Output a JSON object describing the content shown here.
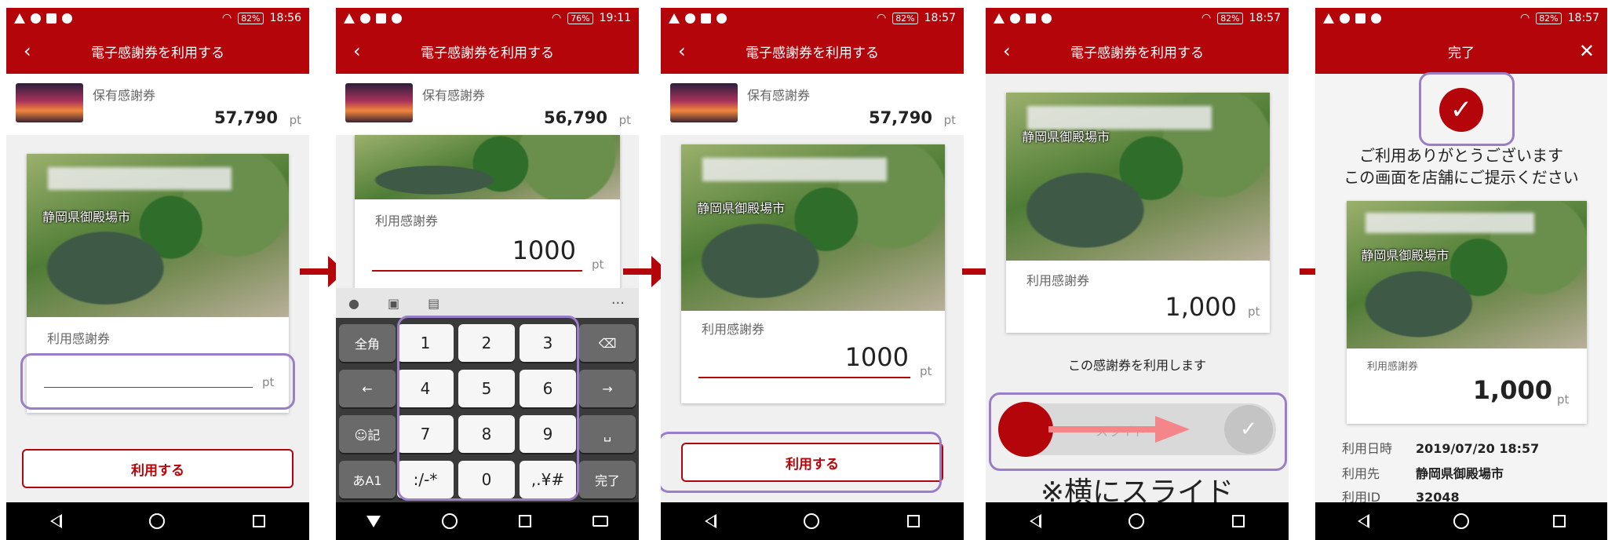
{
  "common": {
    "app_title": "電子感謝券を利用する",
    "balance_label": "保有感謝券",
    "use_label": "利用感謝券",
    "unit": "pt",
    "city": "静岡県御殿場市",
    "use_button": "利用する",
    "back_glyph": "‹"
  },
  "screens": [
    {
      "time": "18:56",
      "battery": "82%",
      "balance": "57,790",
      "amount": ""
    },
    {
      "time": "19:11",
      "battery": "76%",
      "balance": "56,790",
      "amount": "1000"
    },
    {
      "time": "18:57",
      "battery": "82%",
      "balance": "57,790",
      "amount": "1000"
    },
    {
      "time": "18:57",
      "battery": "82%",
      "amount": "1,000",
      "confirm_text": "この感謝券を利用します",
      "slider_text": "スライド",
      "slide_note": "※横にスライド"
    },
    {
      "time": "18:57",
      "battery": "82%",
      "title": "完了",
      "close_glyph": "✕",
      "thanks_line1": "ご利用ありがとうございます",
      "thanks_line2": "この画面を店舗にご提示ください",
      "amount": "1,000",
      "info": [
        {
          "key": "利用日時",
          "value": "2019/07/20 18:57"
        },
        {
          "key": "利用先",
          "value": "静岡県御殿場市"
        },
        {
          "key": "利用ID",
          "value": "32048"
        }
      ]
    }
  ],
  "keyboard": {
    "keys": [
      "1",
      "2",
      "3",
      "4",
      "5",
      "6",
      "7",
      "8",
      "9",
      ":/-*",
      "0",
      ",.¥#"
    ],
    "left_keys": [
      "全角",
      "←",
      "☺記",
      "あA1"
    ],
    "right_keys": [
      "⌫",
      "→",
      "␣",
      "完了"
    ],
    "more": "···"
  },
  "icons": [
    "warning-icon",
    "shield-icon",
    "image-icon",
    "media-icon",
    "wifi-icon",
    "sim-icon",
    "back-icon",
    "home-icon",
    "recent-icon",
    "check-icon",
    "close-icon"
  ]
}
